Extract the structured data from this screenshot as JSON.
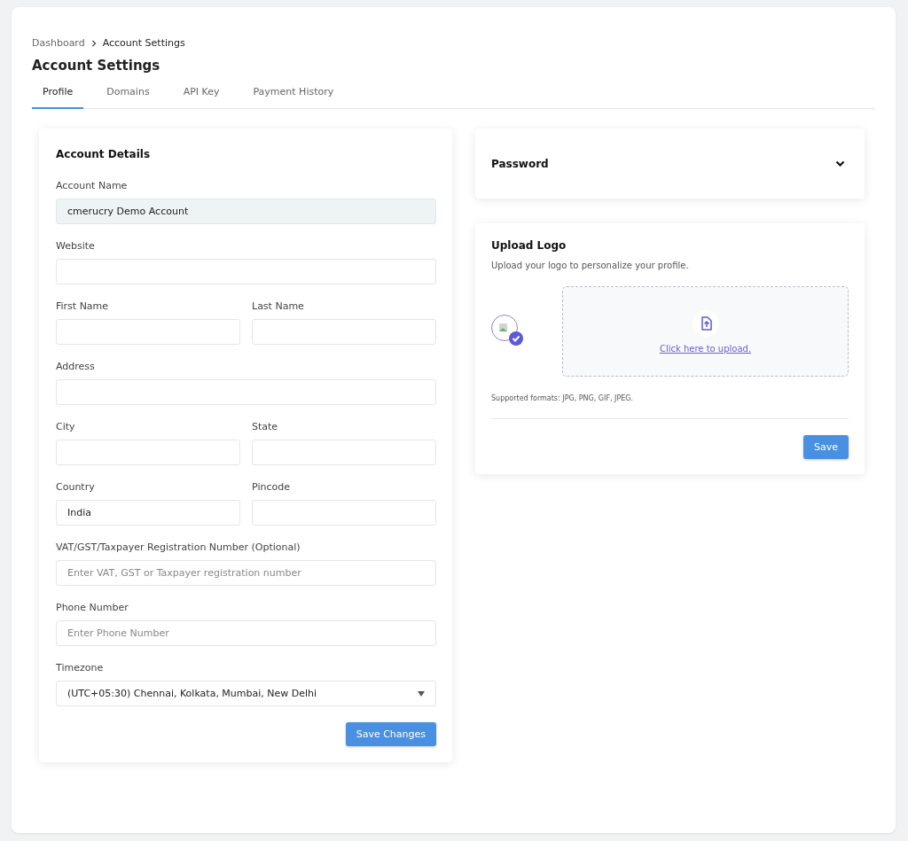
{
  "breadcrumb": [
    {
      "label": "Dashboard",
      "current": false
    },
    {
      "label": "Account Settings",
      "current": true
    }
  ],
  "title": "Account Settings",
  "tabs": [
    {
      "label": "Profile",
      "selected": true
    },
    {
      "label": "Domains",
      "selected": false
    },
    {
      "label": "API Key",
      "selected": false
    },
    {
      "label": "Payment History",
      "selected": false
    }
  ],
  "account_details": {
    "title": "Account Details",
    "rows": [
      [
        {
          "kind": "text",
          "label": "Account Name",
          "value": "cmerucry Demo Account",
          "disabled": true
        }
      ],
      [
        {
          "kind": "text",
          "label": "Website",
          "disabled": false
        }
      ],
      [
        {
          "kind": "text",
          "label": "First Name",
          "disabled": false
        },
        {
          "kind": "text",
          "label": "Last Name",
          "disabled": false
        }
      ],
      [
        {
          "kind": "text",
          "label": "Address",
          "disabled": false
        }
      ],
      [
        {
          "kind": "text",
          "label": "City",
          "disabled": false
        },
        {
          "kind": "text",
          "label": "State",
          "disabled": false
        }
      ],
      [
        {
          "kind": "text",
          "label": "Country",
          "value": "India",
          "disabled": false
        },
        {
          "kind": "text",
          "label": "Pincode",
          "disabled": false
        }
      ],
      [
        {
          "kind": "text",
          "label": "VAT/GST/Taxpayer Registration Number (Optional)",
          "placeholder": "Enter VAT, GST or Taxpayer registration number",
          "disabled": false
        }
      ],
      [
        {
          "kind": "text",
          "label": "Phone Number",
          "placeholder": "Enter Phone Number",
          "disabled": false
        }
      ],
      [
        {
          "kind": "select",
          "label": "Timezone",
          "value": "(UTC+05:30) Chennai, Kolkata, Mumbai, New Delhi",
          "disabled": false
        }
      ]
    ],
    "button": "Save Changes"
  },
  "password": {
    "title": "Password",
    "expanded": false
  },
  "upload_logo": {
    "title": "Upload Logo",
    "description": "Upload your logo to personalize your profile.",
    "link": "Click here to upload.",
    "formats": "Supported formats: JPG, PNG, GIF, JPEG.",
    "button": "Save"
  }
}
